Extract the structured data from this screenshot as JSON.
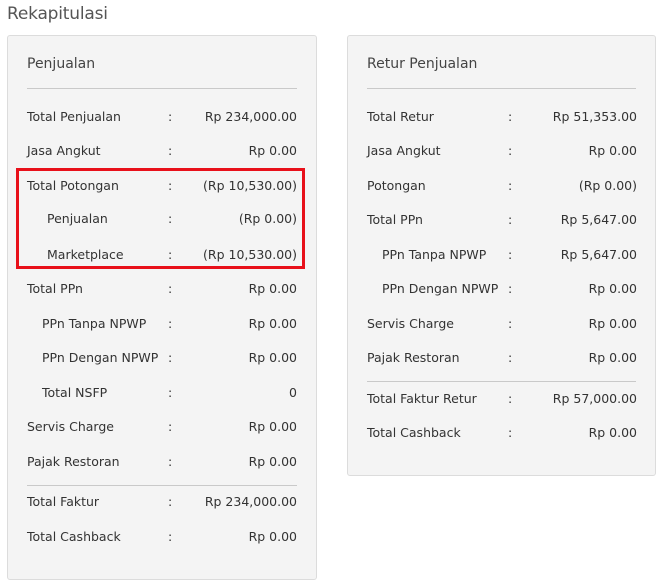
{
  "page_title": "Rekapitulasi",
  "colon": ":",
  "left_panel": {
    "title": "Penjualan",
    "rows": [
      {
        "label": "Total Penjualan",
        "value": "Rp 234,000.00"
      },
      {
        "label": "Jasa Angkut",
        "value": "Rp 0.00"
      },
      {
        "label": "Total Potongan",
        "value": "(Rp 10,530.00)"
      },
      {
        "label": "Penjualan",
        "value": "(Rp 0.00)"
      },
      {
        "label": "Marketplace",
        "value": "(Rp 10,530.00)"
      },
      {
        "label": "Total PPn",
        "value": "Rp 0.00"
      },
      {
        "label": "PPn Tanpa NPWP",
        "value": "Rp 0.00"
      },
      {
        "label": "PPn Dengan NPWP",
        "value": "Rp 0.00"
      },
      {
        "label": "Total NSFP",
        "value": "0"
      },
      {
        "label": "Servis Charge",
        "value": "Rp 0.00"
      },
      {
        "label": "Pajak Restoran",
        "value": "Rp 0.00"
      },
      {
        "label": "Total Faktur",
        "value": "Rp 234,000.00"
      },
      {
        "label": "Total Cashback",
        "value": "Rp 0.00"
      }
    ]
  },
  "right_panel": {
    "title": "Retur Penjualan",
    "rows": [
      {
        "label": "Total Retur",
        "value": "Rp 51,353.00"
      },
      {
        "label": "Jasa Angkut",
        "value": "Rp 0.00"
      },
      {
        "label": "Potongan",
        "value": "(Rp 0.00)"
      },
      {
        "label": "Total PPn",
        "value": "Rp 5,647.00"
      },
      {
        "label": "PPn Tanpa NPWP",
        "value": "Rp 5,647.00"
      },
      {
        "label": "PPn Dengan NPWP",
        "value": "Rp 0.00"
      },
      {
        "label": "Servis Charge",
        "value": "Rp 0.00"
      },
      {
        "label": "Pajak Restoran",
        "value": "Rp 0.00"
      },
      {
        "label": "Total Faktur Retur",
        "value": "Rp 57,000.00"
      },
      {
        "label": "Total Cashback",
        "value": "Rp 0.00"
      }
    ]
  },
  "annotation_color": "#e8101a"
}
